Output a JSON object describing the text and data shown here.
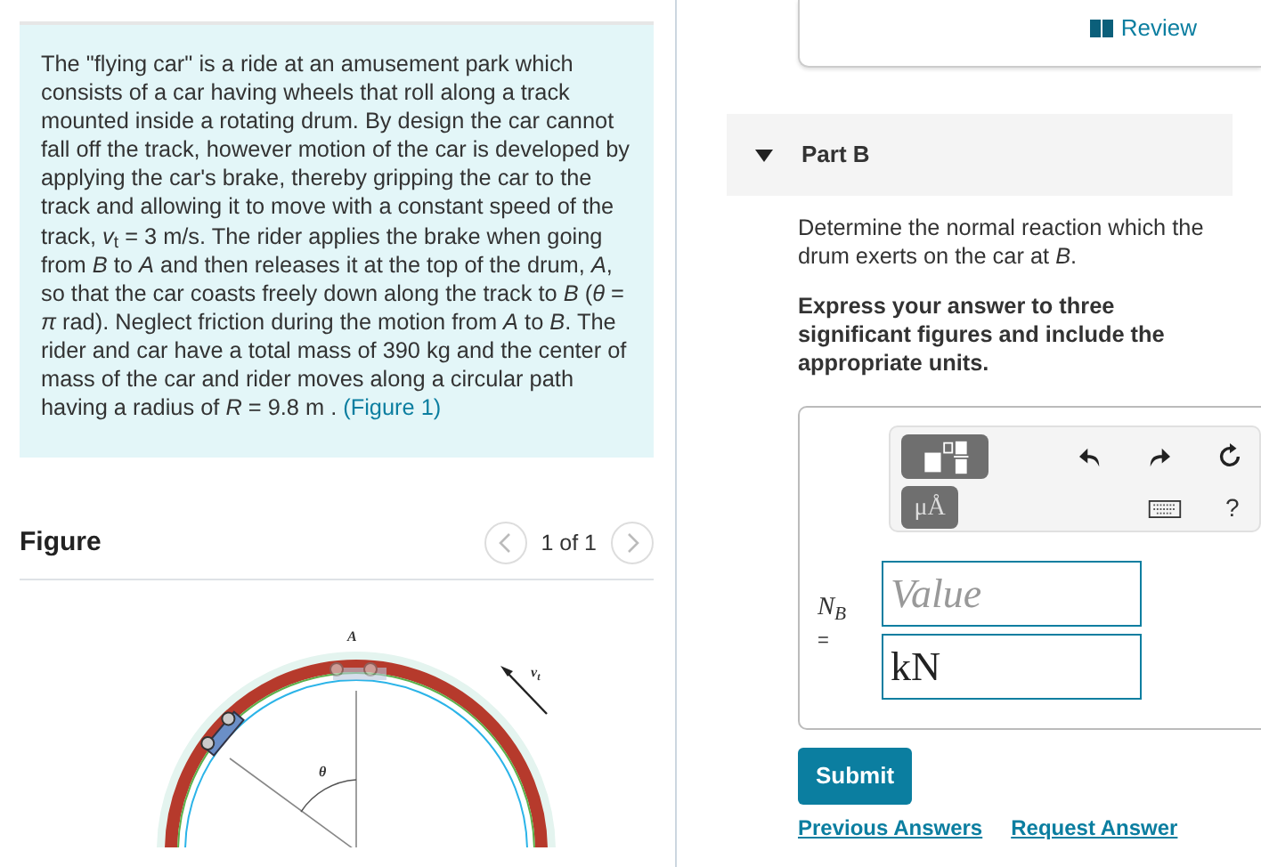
{
  "problem": {
    "text": "The \"flying car\" is a ride at an amusement park which consists of a car having wheels that roll along a track mounted inside a rotating drum. By design the car cannot fall off the track, however motion of the car is developed by applying the car's brake, thereby gripping the car to the track and allowing it to move with a constant speed of the track, *v*$_{t}$ = 3 m/s. The rider applies the brake when going from *B* to *A* and then releases it at the top of the drum, *A*, so that the car coasts freely down along the track to *B* (*θ* = *π* rad). Neglect friction during the motion from *A* to *B*. The rider and car have a total mass of 390  kg and the center of mass of the car and rider moves along a circular path having a radius of *R* = 9.8  m .",
    "figure_link": "(Figure 1)"
  },
  "figure": {
    "title": "Figure",
    "pager": "1 of 1",
    "prev_disabled": true,
    "next_disabled": true,
    "labels": [
      {
        "kind": "point",
        "text": "A"
      },
      {
        "kind": "angle",
        "text": "θ"
      },
      {
        "kind": "speed",
        "text": "v",
        "subscript": "t"
      }
    ]
  },
  "review": "Review",
  "part": {
    "title": "Part B",
    "expanded": true,
    "question": "Determine the normal reaction which the drum exerts on the car at *B*.",
    "instruction": "Express your answer to three significant figures and include the appropriate units."
  },
  "answer": {
    "units_button": "μÅ",
    "help": "?",
    "label": "N$_{B}$",
    "equals": "=",
    "value_placeholder": "Value",
    "units_value": "kN"
  },
  "buttons": {
    "submit": "Submit",
    "links": [
      "Previous Answers",
      "Request Answer"
    ]
  }
}
